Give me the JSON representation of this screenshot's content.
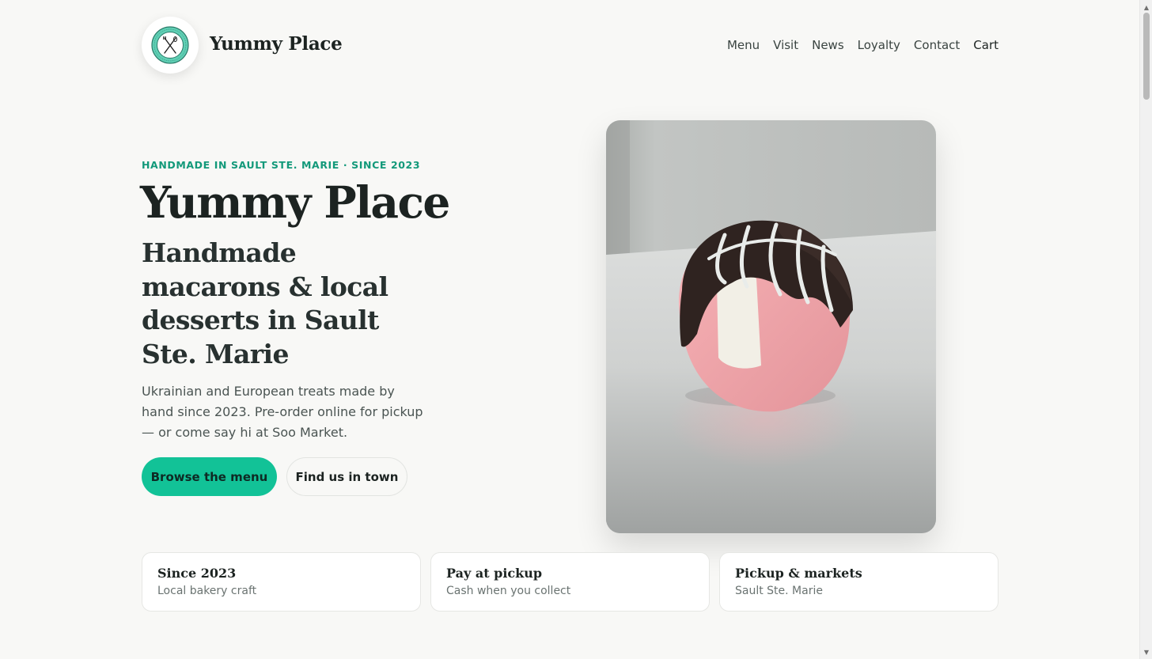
{
  "header": {
    "brand": "Yummy Place",
    "logo_icon": "bakery-badge-logo",
    "nav": [
      "Menu",
      "Visit",
      "News",
      "Loyalty",
      "Contact",
      "Cart"
    ]
  },
  "hero": {
    "eyebrow": "HANDMADE IN SAULT STE. MARIE · SINCE 2023",
    "title": "Yummy Place",
    "subtitle": "Handmade macarons & local desserts in Sault Ste. Marie",
    "description": "Ukrainian and European treats made by hand since 2023. Pre-order online for pickup — or come say hi at Soo Market.",
    "primary_button": "Browse the menu",
    "secondary_button": "Find us in town",
    "image_subject": "chocolate-dipped-pink-macaron"
  },
  "features": [
    {
      "title": "Since 2023",
      "subtitle": "Local bakery craft"
    },
    {
      "title": "Pay at pickup",
      "subtitle": "Cash when you collect"
    },
    {
      "title": "Pickup & markets",
      "subtitle": "Sault Ste. Marie"
    }
  ],
  "colors": {
    "accent": "#12c297",
    "eyebrow": "#12997a",
    "background": "#f8f8f6",
    "text": "#1c2321"
  }
}
